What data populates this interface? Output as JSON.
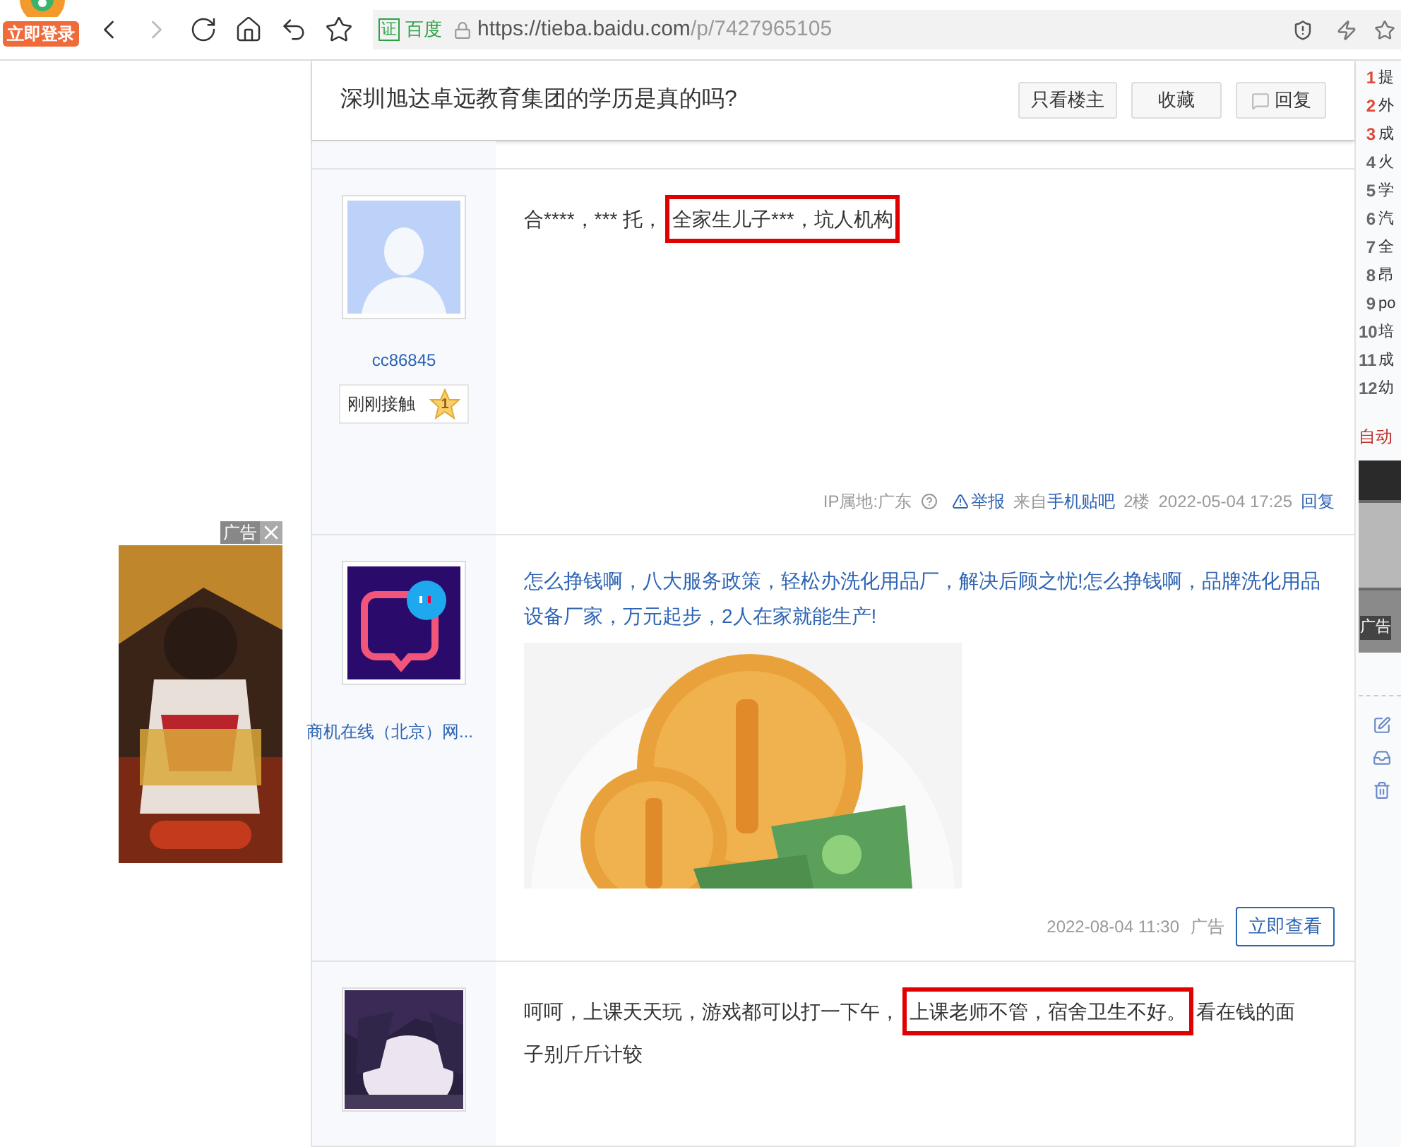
{
  "browser": {
    "login_badge": "立即登录",
    "forward_disabled": true,
    "cert_badge": "证",
    "cert_issuer": "百度",
    "url_host": "https://tieba.baidu.com",
    "url_path": "/p/7427965105"
  },
  "side_ad": {
    "label": "广告"
  },
  "thread": {
    "title": "深圳旭达卓远教育集团的学历是真的吗?",
    "buttons": [
      {
        "label": "只看楼主",
        "kind": "plain"
      },
      {
        "label": "收藏",
        "kind": "plain"
      },
      {
        "label": "回复",
        "kind": "reply"
      }
    ]
  },
  "posts": [
    {
      "kind": "post",
      "avatar": {
        "kind": "default"
      },
      "user": "cc86845",
      "badge": "刚刚接触",
      "rank": "1",
      "segments": [
        {
          "text": "合****，*** 托，",
          "boxed": false
        },
        {
          "text": "全家生儿子***，坑人机构",
          "boxed": true
        }
      ],
      "ip": "IP属地:广东",
      "report": "举报",
      "source_prefix": "来自",
      "source": "手机贴吧",
      "floor": "2楼",
      "time": "2022-05-04 17:25",
      "reply": "回复"
    },
    {
      "kind": "ad",
      "avatar": {
        "kind": "logo"
      },
      "user": "商机在线（北京）网...",
      "text": "怎么挣钱啊，八大服务政策，轻松办洗化用品厂，解决后顾之忧!怎么挣钱啊，品牌洗化用品设备厂家，万元起步，2人在家就能生产!",
      "time": "2022-08-04 11:30",
      "ad_label": "广告",
      "action": "立即查看"
    },
    {
      "kind": "post",
      "segments": [
        {
          "text": "呵呵，上课天天玩，游戏都可以打一下午，",
          "boxed": false
        },
        {
          "text": "上课老师不管，宿舍卫生不好。",
          "boxed": true
        },
        {
          "text": "看在钱的面子别斤斤计较",
          "boxed": false
        }
      ]
    }
  ],
  "sidebar": {
    "hot": [
      {
        "rank": "1",
        "text": "提",
        "top": true
      },
      {
        "rank": "2",
        "text": "外",
        "top": true
      },
      {
        "rank": "3",
        "text": "成",
        "top": true
      },
      {
        "rank": "4",
        "text": "火",
        "top": false
      },
      {
        "rank": "5",
        "text": "学",
        "top": false
      },
      {
        "rank": "6",
        "text": "汽",
        "top": false
      },
      {
        "rank": "7",
        "text": "全",
        "top": false
      },
      {
        "rank": "8",
        "text": "昂",
        "top": false
      },
      {
        "rank": "9",
        "text": "po",
        "top": false
      },
      {
        "rank": "10",
        "text": "培",
        "top": false
      },
      {
        "rank": "11",
        "text": "成",
        "top": false
      },
      {
        "rank": "12",
        "text": "幼",
        "top": false
      }
    ],
    "auto_label": "自动",
    "ad_label": "广告"
  }
}
